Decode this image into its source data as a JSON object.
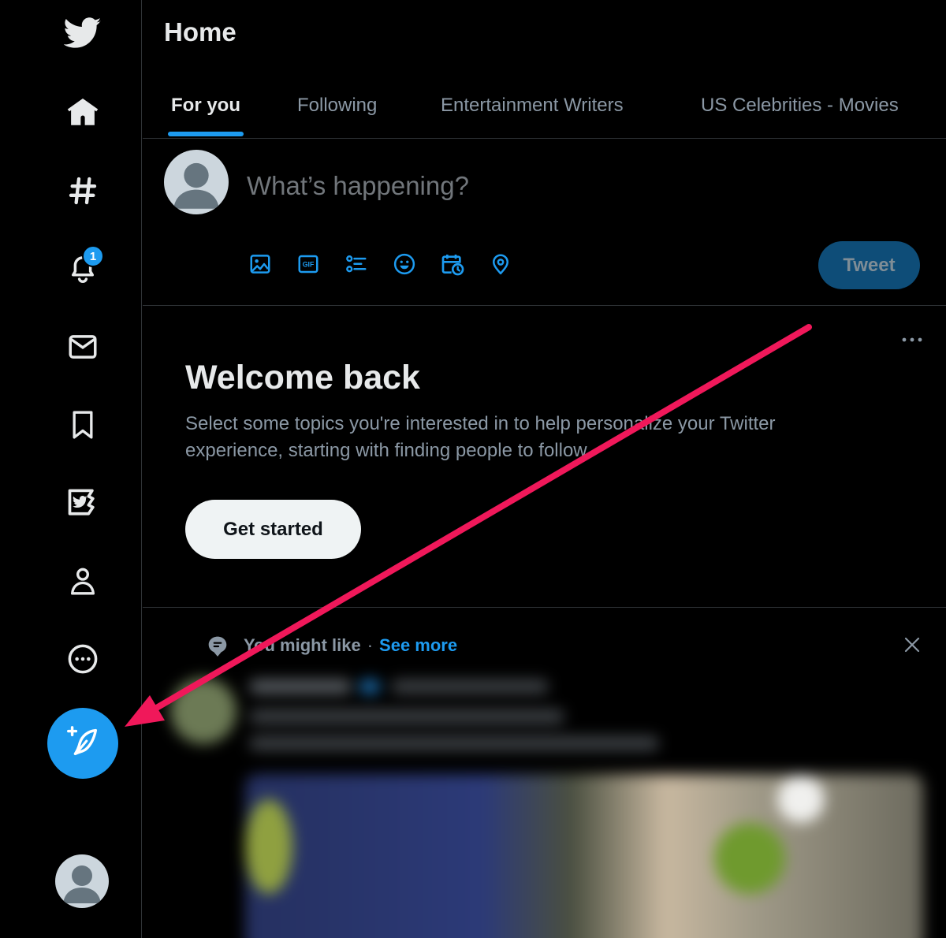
{
  "nav": {
    "items": [
      {
        "name": "home",
        "icon": "home-icon"
      },
      {
        "name": "explore",
        "icon": "hashtag-icon"
      },
      {
        "name": "notifications",
        "icon": "bell-icon",
        "badge": "1"
      },
      {
        "name": "messages",
        "icon": "envelope-icon"
      },
      {
        "name": "bookmarks",
        "icon": "bookmark-icon"
      },
      {
        "name": "twitter-blue",
        "icon": "twitter-blue-icon"
      },
      {
        "name": "profile",
        "icon": "person-icon"
      },
      {
        "name": "more",
        "icon": "more-circle-icon"
      }
    ],
    "compose_icon": "feather-plus-icon",
    "logo_icon": "twitter-bird-icon"
  },
  "header": {
    "title": "Home",
    "tabs": [
      {
        "label": "For you",
        "active": true
      },
      {
        "label": "Following",
        "active": false
      },
      {
        "label": "Entertainment Writers",
        "active": false
      },
      {
        "label": "US Celebrities - Movies",
        "active": false
      }
    ]
  },
  "composer": {
    "placeholder": "What’s happening?",
    "tools": [
      "image-icon",
      "gif-icon",
      "poll-icon",
      "emoji-icon",
      "schedule-icon",
      "location-icon"
    ],
    "tweet_label": "Tweet"
  },
  "welcome": {
    "title": "Welcome back",
    "text": "Select some topics you're interested in to help personalize your Twitter experience, starting with finding people to follow.",
    "button_label": "Get started"
  },
  "suggestions": {
    "label": "You might like",
    "separator": "·",
    "see_more": "See more"
  },
  "colors": {
    "accent": "#1d9bf0",
    "background": "#000000",
    "annotation_arrow": "#f0185a"
  }
}
